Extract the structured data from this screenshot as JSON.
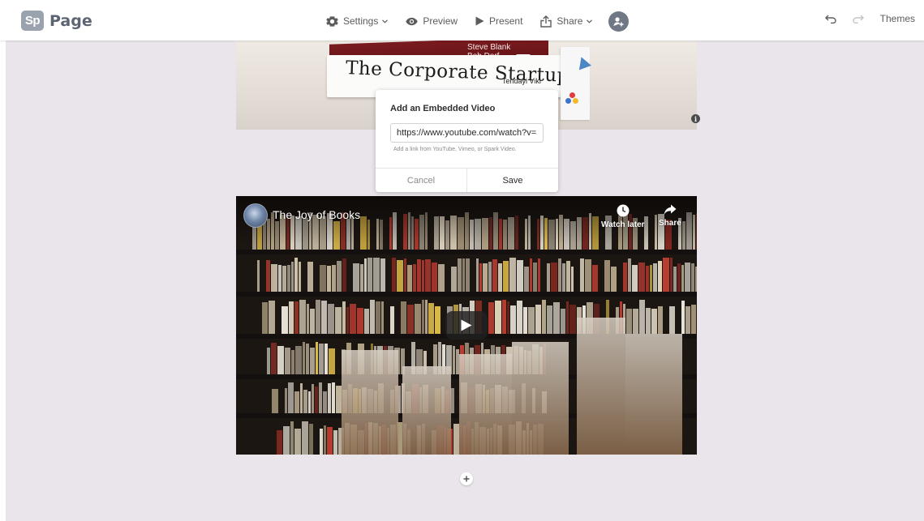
{
  "app": {
    "logo_badge": "Sp",
    "logo_text": "Page"
  },
  "toolbar": {
    "settings_label": "Settings",
    "preview_label": "Preview",
    "present_label": "Present",
    "share_label": "Share",
    "themes_label": "Themes",
    "icons": [
      "gear-icon",
      "eye-icon",
      "play-icon",
      "share-icon",
      "user-add-icon",
      "undo-icon",
      "redo-icon"
    ]
  },
  "image_block": {
    "book_top_author": [
      "Steve Blank",
      "Bob Dorf"
    ],
    "book_title": "The Corporate Startup",
    "book_author": "Tendayi Viki"
  },
  "embed_dialog": {
    "title": "Add an Embedded Video",
    "url_value": "https://www.youtube.com/watch?v=SK",
    "hint": "Add a link from YouTube, Vimeo, or Spark Video.",
    "cancel_label": "Cancel",
    "save_label": "Save"
  },
  "video": {
    "title": "The Joy of Books",
    "watch_later_label": "Watch later",
    "share_label": "Share"
  },
  "colors": {
    "canvas_bg": "#e9e5ea",
    "topbar_bg": "#ffffff",
    "logo_badge": "#9aa3ad",
    "text_muted": "#5c5c5c"
  }
}
